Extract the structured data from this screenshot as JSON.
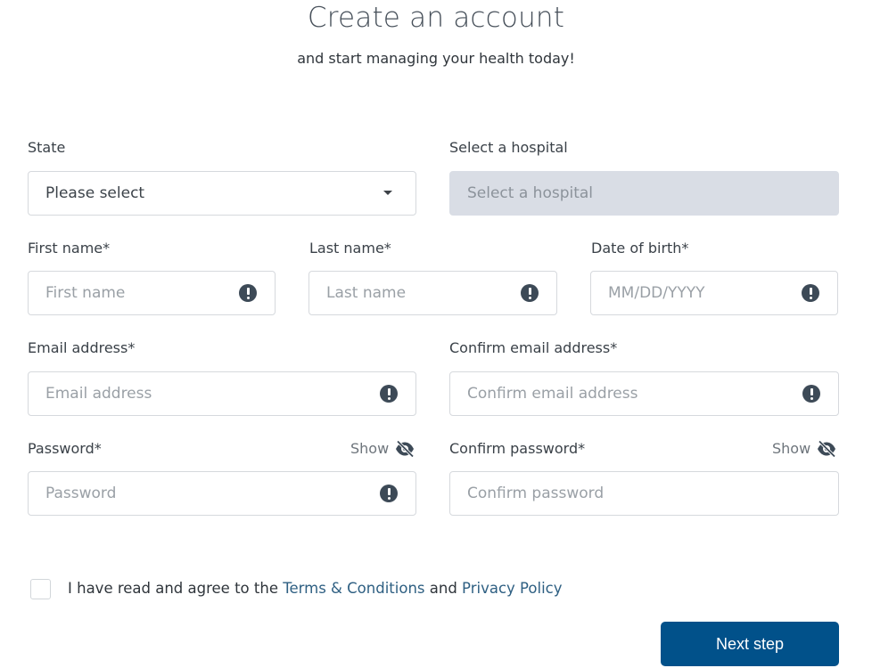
{
  "header": {
    "title": "Create an account",
    "subtitle": "and start managing your health today!"
  },
  "form": {
    "state": {
      "label": "State",
      "value": "Please select",
      "icon": "caret-down-icon"
    },
    "hospital": {
      "label": "Select a hospital",
      "placeholder": "Select a hospital",
      "disabled": true
    },
    "first_name": {
      "label": "First name*",
      "placeholder": "First name",
      "icon": "alert-icon"
    },
    "last_name": {
      "label": "Last name*",
      "placeholder": "Last name",
      "icon": "alert-icon"
    },
    "dob": {
      "label": "Date of birth*",
      "placeholder": "MM/DD/YYYY",
      "icon": "alert-icon"
    },
    "email": {
      "label": "Email address*",
      "placeholder": "Email address",
      "icon": "alert-icon"
    },
    "confirm_email": {
      "label": "Confirm email address*",
      "placeholder": "Confirm email address",
      "icon": "alert-icon"
    },
    "password": {
      "label": "Password*",
      "placeholder": "Password",
      "toggle_label": "Show",
      "toggle_icon": "eye-slash-icon",
      "icon": "alert-icon"
    },
    "confirm_password": {
      "label": "Confirm password*",
      "placeholder": "Confirm password",
      "toggle_label": "Show",
      "toggle_icon": "eye-slash-icon"
    }
  },
  "agreement": {
    "checked": false,
    "prefix": "I have read and agree to the ",
    "terms_link": "Terms & Conditions",
    "middle": " and ",
    "privacy_link": "Privacy Policy"
  },
  "actions": {
    "next_label": "Next step"
  },
  "colors": {
    "primary": "#01518a",
    "link": "#2e5f82",
    "alert_icon": "#3d4a57",
    "disabled_field": "#d9dde5"
  }
}
